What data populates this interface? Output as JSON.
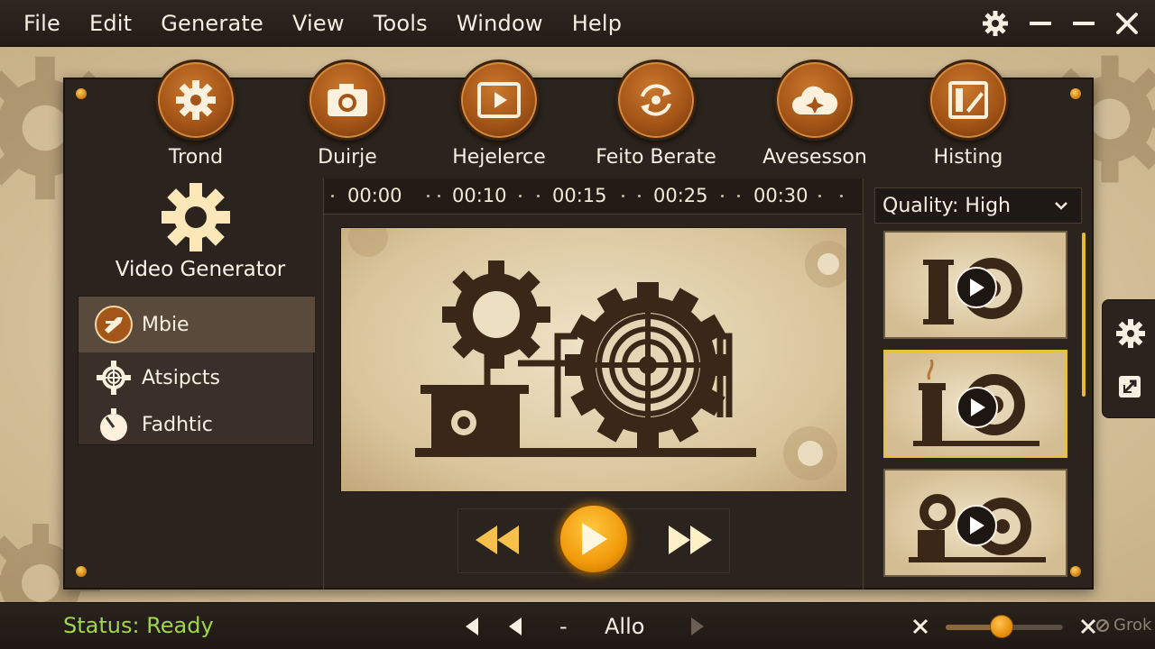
{
  "menu": [
    "File",
    "Edit",
    "Generate",
    "View",
    "Tools",
    "Window",
    "Help"
  ],
  "window_controls": [
    "gear-icon",
    "minimize-icon",
    "close-icon"
  ],
  "toolbar": [
    {
      "label": "Trond",
      "icon": "gear-icon"
    },
    {
      "label": "Duirje",
      "icon": "camera-icon"
    },
    {
      "label": "Hejelerce",
      "icon": "video-frame-icon"
    },
    {
      "label": "Feito Berate",
      "icon": "refresh-icon"
    },
    {
      "label": "Avesesson",
      "icon": "cloud-icon"
    },
    {
      "label": "Histing",
      "icon": "edit-frame-icon"
    }
  ],
  "sidebar": {
    "title": "Video Generator",
    "title_icon": "gear-icon",
    "items": [
      {
        "label": "Mbie",
        "icon": "brush-icon",
        "active": true
      },
      {
        "label": "Atsipcts",
        "icon": "target-icon",
        "active": false
      },
      {
        "label": "Fadhtic",
        "icon": "timer-icon",
        "active": false
      }
    ]
  },
  "timeline": {
    "labels": [
      "00:00",
      "00:10",
      "00:15",
      "00:25",
      "00:30"
    ]
  },
  "transport": {
    "buttons": [
      "rewind-icon",
      "play-icon",
      "fast-forward-icon"
    ]
  },
  "quality": {
    "value": "Quality: High"
  },
  "thumbnails": [
    {
      "name": "clip-1",
      "selected": false
    },
    {
      "name": "clip-2",
      "selected": true
    },
    {
      "name": "clip-3",
      "selected": false
    }
  ],
  "side_tools": [
    "gear-icon",
    "export-icon"
  ],
  "status": {
    "text": "Status: Ready",
    "separator": "-",
    "center_label": "Allo",
    "volume": 0.48
  },
  "watermark": "Grok",
  "colors": {
    "accent": "#f29a0b",
    "status_ready": "#9fd64a",
    "panel": "#2b231d",
    "highlight": "#e6c23c"
  }
}
